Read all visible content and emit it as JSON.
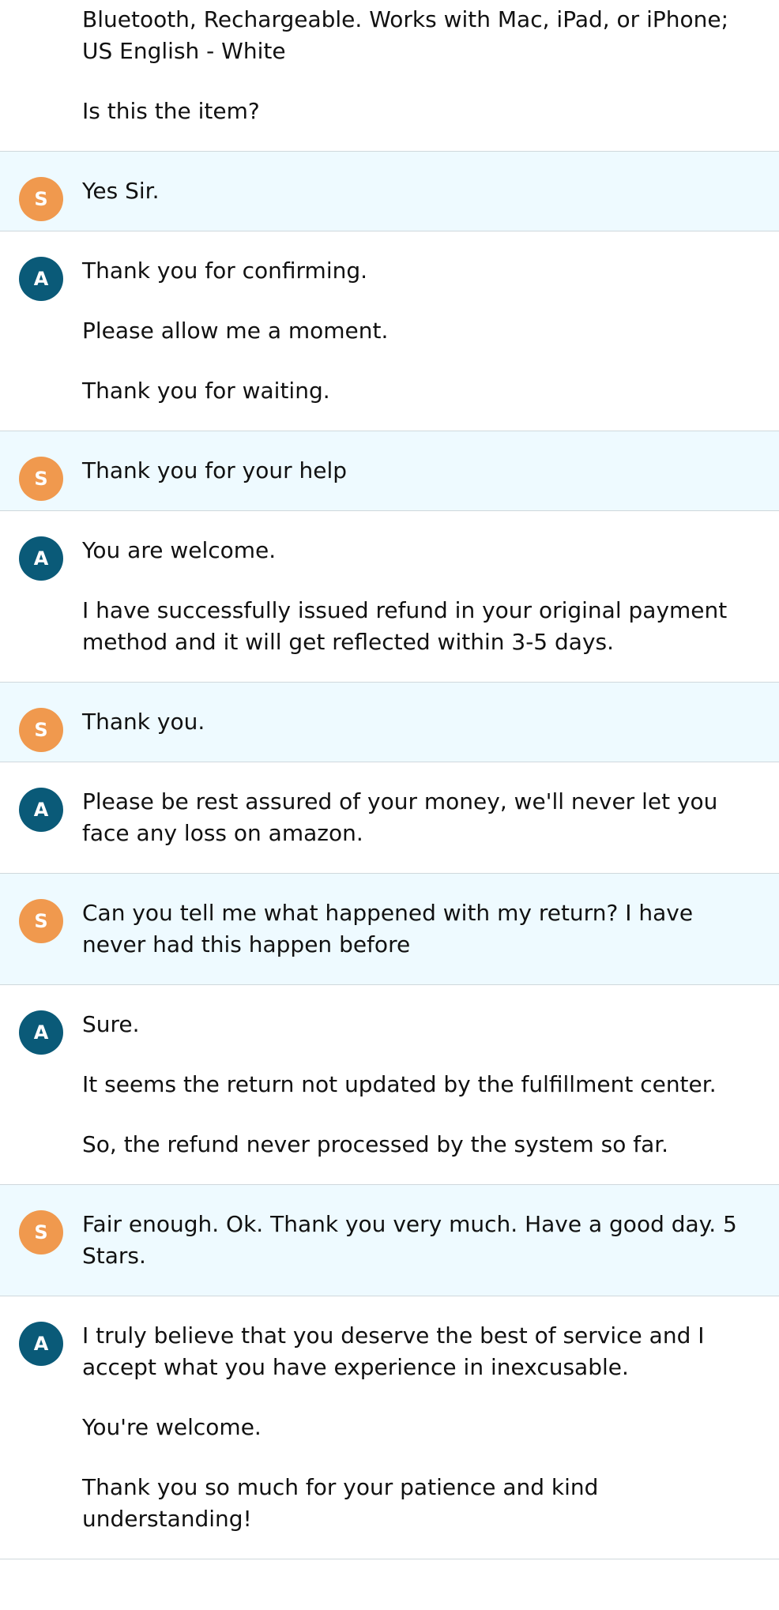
{
  "conversation": [
    {
      "role": "agent",
      "initial": "",
      "lines": [
        "Bluetooth, Rechargeable. Works with Mac, iPad, or iPhone; US English - White",
        "Is this the item?"
      ]
    },
    {
      "role": "customer",
      "initial": "S",
      "lines": [
        "Yes Sir."
      ]
    },
    {
      "role": "agent",
      "initial": "A",
      "lines": [
        "Thank you for confirming.",
        "Please allow me a moment.",
        "Thank you for waiting."
      ]
    },
    {
      "role": "customer",
      "initial": "S",
      "lines": [
        "Thank you for your help"
      ]
    },
    {
      "role": "agent",
      "initial": "A",
      "lines": [
        "You are welcome.",
        "I have successfully issued refund in your original payment method and it will get reflected within 3-5 days."
      ]
    },
    {
      "role": "customer",
      "initial": "S",
      "lines": [
        "Thank you."
      ]
    },
    {
      "role": "agent",
      "initial": "A",
      "lines": [
        "Please be rest assured of your money, we'll never let you face any loss on amazon."
      ]
    },
    {
      "role": "customer",
      "initial": "S",
      "lines": [
        "Can you tell me what happened with my return? I have never had this happen before"
      ]
    },
    {
      "role": "agent",
      "initial": "A",
      "lines": [
        "Sure.",
        "It seems the return not updated by the fulfillment center.",
        "So, the refund never processed by the system so far."
      ]
    },
    {
      "role": "customer",
      "initial": "S",
      "lines": [
        "Fair enough. Ok. Thank you very much. Have a good day. 5 Stars."
      ]
    },
    {
      "role": "agent",
      "initial": "A",
      "lines": [
        "I truly believe that you deserve the best of service and I accept what you have experience in inexcusable.",
        "You're welcome.",
        "Thank you so much for your patience and kind understanding!"
      ]
    }
  ]
}
